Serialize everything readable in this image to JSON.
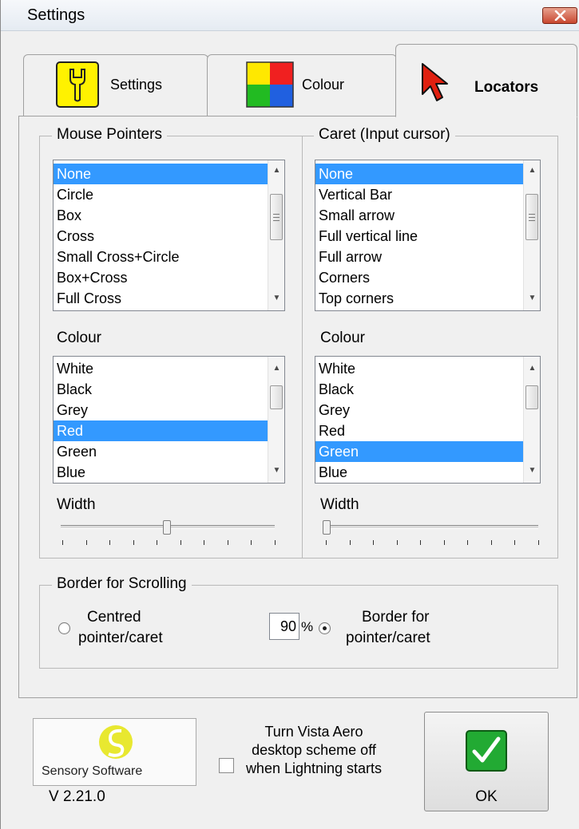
{
  "window": {
    "title": "Settings"
  },
  "tabs": [
    {
      "label": "Settings",
      "icon": "wrench-icon"
    },
    {
      "label": "Colour",
      "icon": "colour-squares-icon"
    },
    {
      "label": "Locators",
      "icon": "red-pointer-icon"
    }
  ],
  "mouse": {
    "group_title": "Mouse Pointers",
    "pointers": [
      "None",
      "Circle",
      "Box",
      "Cross",
      "Small Cross+Circle",
      "Box+Cross",
      "Full Cross"
    ],
    "colour_label": "Colour",
    "colours": [
      "White",
      "Black",
      "Grey",
      "Red",
      "Green",
      "Blue"
    ],
    "width_label": "Width"
  },
  "caret": {
    "group_title": "Caret (Input cursor)",
    "shapes": [
      "None",
      "Vertical Bar",
      "Small arrow",
      "Full vertical line",
      "Full arrow",
      "Corners",
      "Top corners"
    ],
    "colour_label": "Colour",
    "colours": [
      "White",
      "Black",
      "Grey",
      "Red",
      "Green",
      "Blue"
    ],
    "width_label": "Width"
  },
  "scrolling": {
    "group_title": "Border for Scrolling",
    "option1_line1": "Centred",
    "option1_line2": "pointer/caret",
    "percent_value": "90",
    "percent_symbol": "%",
    "option2_line1": "Border for",
    "option2_line2": "pointer/caret"
  },
  "footer": {
    "logo_text": "Sensory Software",
    "version": "V 2.21.0",
    "checkbox_label": "Turn Vista Aero desktop scheme off when Lightning starts",
    "ok_label": "OK"
  },
  "colors": {
    "selection": "#3399ff",
    "locator_arrow": "#e02010",
    "ok_check": "#22aa33"
  }
}
